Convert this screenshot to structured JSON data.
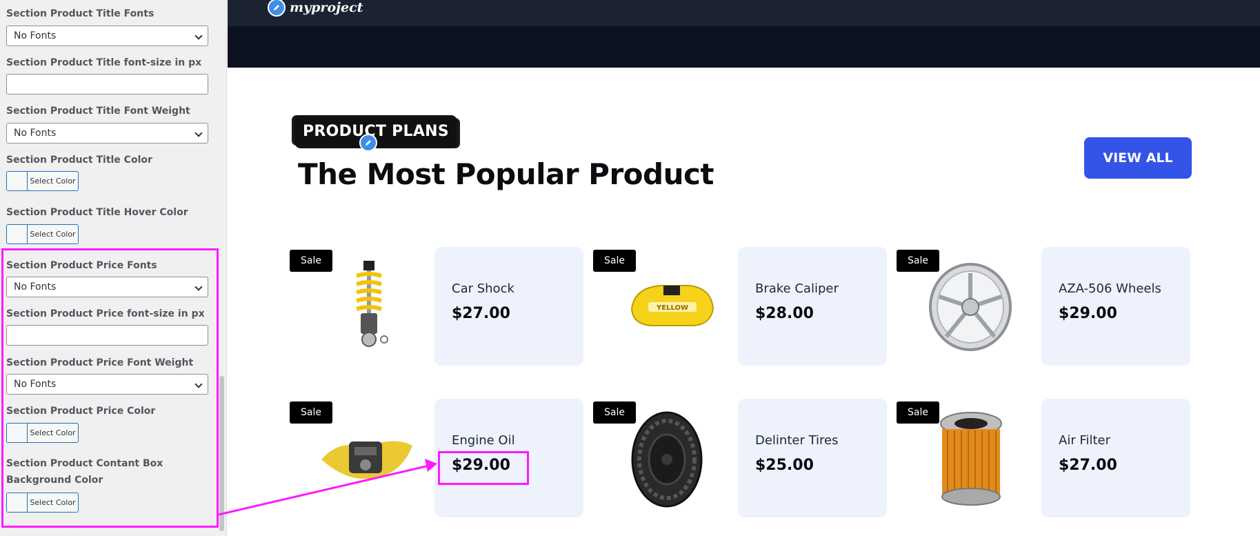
{
  "sidebar": {
    "fields": [
      {
        "label": "Section Product Title Fonts",
        "value": "No Fonts"
      },
      {
        "label": "Section Product Title font-size in px",
        "value": ""
      },
      {
        "label": "Section Product Title Font Weight",
        "value": "No Fonts"
      },
      {
        "label": "Section Product Title Color",
        "button": "Select Color"
      },
      {
        "label": "Section Product Title Hover Color",
        "button": "Select Color"
      },
      {
        "label": "Section Product Price Fonts",
        "value": "No Fonts"
      },
      {
        "label": "Section Product Price font-size in px",
        "value": ""
      },
      {
        "label": "Section Product Price Font Weight",
        "value": "No Fonts"
      },
      {
        "label": "Section Product Price Color",
        "button": "Select Color"
      },
      {
        "label": "Section Product Contant Box Background Color",
        "button": "Select Color"
      }
    ]
  },
  "site": {
    "logo": "myproject",
    "badge": "PRODUCT PLANS",
    "heading": "The Most Popular Product",
    "view_all": "VIEW ALL",
    "sale_label": "Sale",
    "products": [
      {
        "name": "Car Shock",
        "price": "$27.00",
        "image": "coilover-shock"
      },
      {
        "name": "Brake Caliper",
        "price": "$28.00",
        "image": "yellow-brake-caliper"
      },
      {
        "name": "AZA-506 Wheels",
        "price": "$29.00",
        "image": "chrome-wheel"
      },
      {
        "name": "Engine Oil",
        "price": "$29.00",
        "image": "engine-oil-splash"
      },
      {
        "name": "Delinter Tires",
        "price": "$25.00",
        "image": "offroad-tire"
      },
      {
        "name": "Air Filter",
        "price": "$27.00",
        "image": "oil-filter"
      }
    ]
  },
  "colors": {
    "highlight": "#ff1aff",
    "accent": "#3354e6",
    "card_bg": "#eef2fd",
    "header_dark": "#1b2333"
  }
}
